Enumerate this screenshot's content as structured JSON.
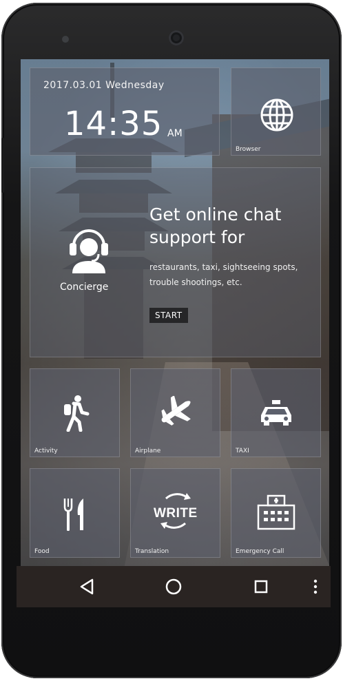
{
  "status": {
    "date": "2017.03.01 Wednesday",
    "time": "14:35",
    "ampm": "AM"
  },
  "tiles": {
    "browser": {
      "label": "Browser",
      "icon": "globe-icon"
    },
    "concierge": {
      "label": "Concierge",
      "icon": "headset-agent-icon",
      "title": "Get online chat support for",
      "subtitle": "restaurants, taxi, sightseeing spots, trouble shootings, etc.",
      "start_label": "START"
    },
    "activity": {
      "label": "Activity",
      "icon": "hiker-icon"
    },
    "airplane": {
      "label": "Airplane",
      "icon": "airplane-icon"
    },
    "taxi": {
      "label": "TAXI",
      "icon": "taxi-icon"
    },
    "food": {
      "label": "Food",
      "icon": "fork-knife-icon"
    },
    "translation": {
      "label": "Translation",
      "icon_text": "WRITE",
      "icon": "refresh-arrows-icon"
    },
    "emergency": {
      "label": "Emergency Call",
      "icon": "hospital-icon"
    }
  },
  "navbar": {
    "back": "back-icon",
    "home": "home-icon",
    "recents": "recents-icon",
    "menu": "more-vert-icon"
  },
  "colors": {
    "tile_bg": "#5c606c",
    "phone_body": "#151516",
    "navbar_bg": "#2a2422"
  }
}
